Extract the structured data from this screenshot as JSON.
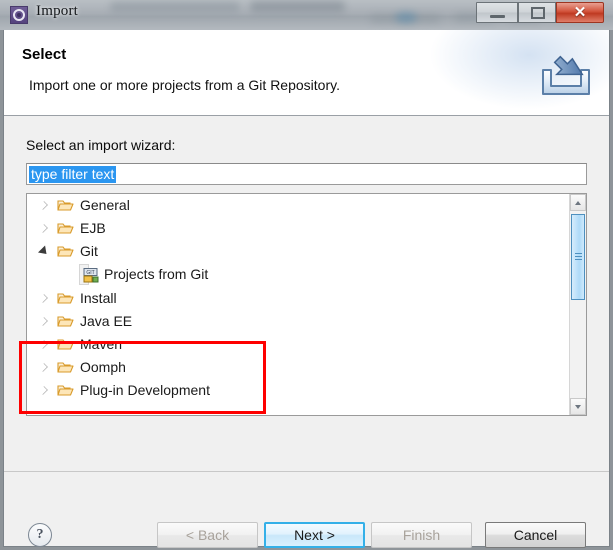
{
  "window": {
    "title": "Import",
    "icon": "eclipse-gear-icon",
    "controls": {
      "minimize": "minimize-button",
      "maximize": "maximize-button",
      "close_glyph": "✕"
    }
  },
  "header": {
    "title": "Select",
    "description": "Import one or more projects from a Git Repository.",
    "icon": "import-wizard-icon"
  },
  "content": {
    "wizard_label": "Select an import wizard:",
    "filter": {
      "value": "type filter text",
      "placeholder": "type filter text",
      "selected": true
    },
    "tree": [
      {
        "label": "General",
        "type": "folder",
        "expanded": false,
        "level": 0
      },
      {
        "label": "EJB",
        "type": "folder",
        "expanded": false,
        "level": 0
      },
      {
        "label": "Git",
        "type": "folder",
        "expanded": true,
        "level": 0
      },
      {
        "label": "Projects from Git",
        "type": "wizard",
        "level": 1,
        "highlighted": true
      },
      {
        "label": "Install",
        "type": "folder",
        "expanded": false,
        "level": 0
      },
      {
        "label": "Java EE",
        "type": "folder",
        "expanded": false,
        "level": 0
      },
      {
        "label": "Maven",
        "type": "folder",
        "expanded": false,
        "level": 0
      },
      {
        "label": "Oomph",
        "type": "folder",
        "expanded": false,
        "level": 0
      },
      {
        "label": "Plug-in Development",
        "type": "folder",
        "expanded": false,
        "level": 0
      }
    ],
    "scrollbar": {
      "up_arrow": "scroll-up-arrow",
      "down_arrow": "scroll-down-arrow"
    },
    "annotation": {
      "type": "rectangle-highlight",
      "color": "#fe0000"
    }
  },
  "footer": {
    "help_label": "?",
    "buttons": [
      {
        "label": "< Back",
        "name": "back-button",
        "enabled": false,
        "default": false
      },
      {
        "label": "Next >",
        "name": "next-button",
        "enabled": true,
        "default": true
      },
      {
        "label": "Finish",
        "name": "finish-button",
        "enabled": false,
        "default": false
      },
      {
        "label": "Cancel",
        "name": "cancel-button",
        "enabled": true,
        "default": false
      }
    ]
  },
  "colors": {
    "accent": "#34b0e8",
    "selection": "#2b96f0",
    "annotation": "#fe0000",
    "folder": "#e8a33d"
  }
}
